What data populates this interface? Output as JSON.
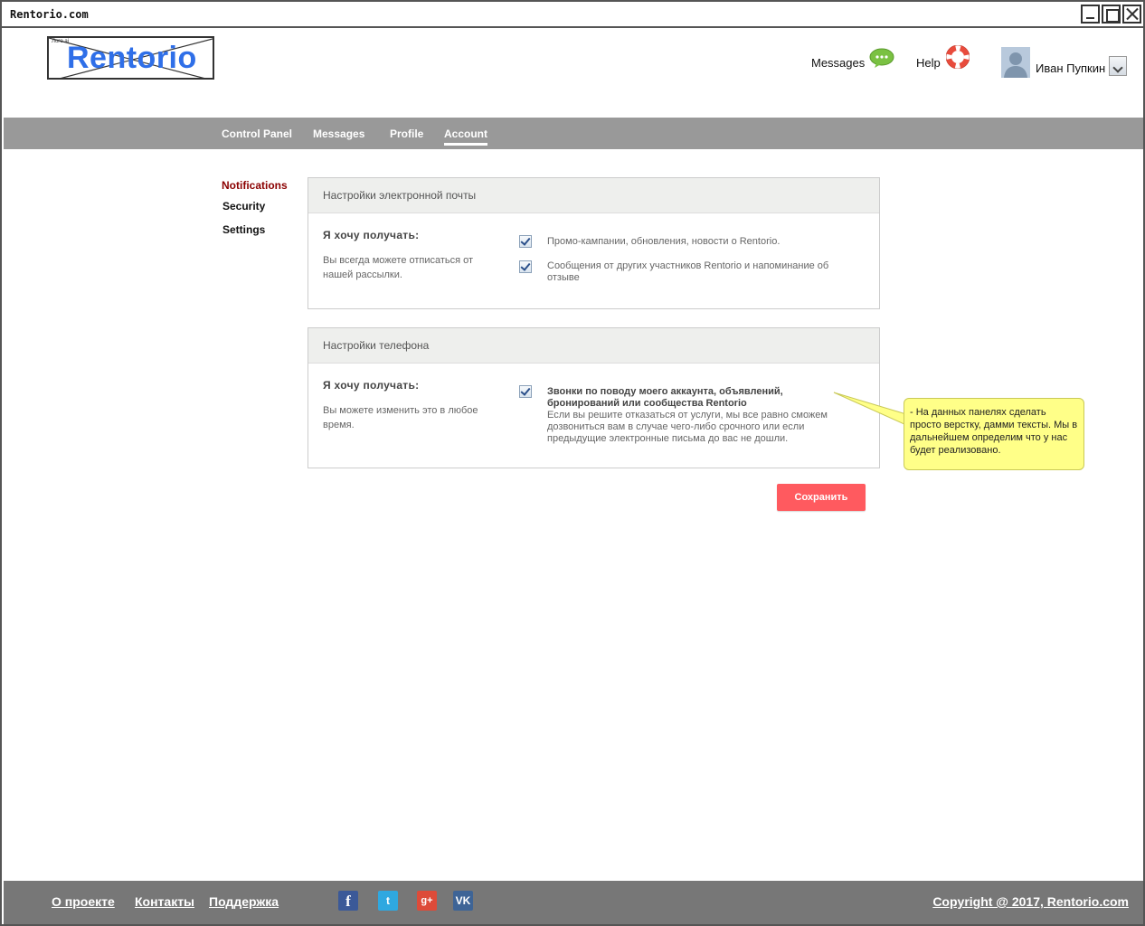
{
  "window": {
    "title": "Rentorio.com"
  },
  "header": {
    "logo_text": "Rentorio",
    "logo_small_text": "Лого.ai",
    "messages_label": "Messages",
    "help_label": "Help",
    "user_name": "Иван Пупкин"
  },
  "nav": {
    "items": [
      {
        "label": "Control Panel"
      },
      {
        "label": "Messages"
      },
      {
        "label": "Profile"
      },
      {
        "label": "Account",
        "active": true
      }
    ]
  },
  "sidebar": {
    "items": [
      {
        "label": "Notifications",
        "active": true
      },
      {
        "label": "Security"
      },
      {
        "label": "Settings"
      }
    ]
  },
  "email_panel": {
    "title": "Настройки электронной почты",
    "want_label": "Я хочу получать:",
    "note": "Вы всегда можете отписаться от нашей рассылки.",
    "options": [
      {
        "text": "Промо-кампании, обновления, новости о Rentorio.",
        "checked": true
      },
      {
        "text": "Сообщения от других участников Rentorio и напоминание об отзыве",
        "checked": true
      }
    ]
  },
  "phone_panel": {
    "title": "Настройки телефона",
    "want_label": "Я хочу получать:",
    "note": "Вы можете изменить это в любое время.",
    "option_title": "Звонки по поводу моего аккаунта, объявлений, бронирований или сообщества Rentorio",
    "option_text": "Если вы решите отказаться от услуги, мы все равно сможем дозвониться вам в случае чего-либо срочного или если предыдущие электронные письма до вас не дошли.",
    "checked": true
  },
  "save_button": {
    "label": "Сохранить"
  },
  "callout": {
    "text": "- На данных панелях сделать просто верстку, дамми тексты. Мы в дальнейшем определим что у нас будет реализовано."
  },
  "footer": {
    "links": [
      "О проекте",
      "Контакты",
      "Поддержка"
    ],
    "social": [
      "f",
      "t",
      "g+",
      "VK"
    ],
    "copyright": "Copyright @ 2017, Rentorio.com"
  },
  "colors": {
    "brand_blue": "#2f6fe8",
    "nav_bg": "#999999",
    "footer_bg": "#777777",
    "save_button": "#ff5a5f",
    "active_side": "#8b0000",
    "callout_bg": "#ffff88"
  }
}
